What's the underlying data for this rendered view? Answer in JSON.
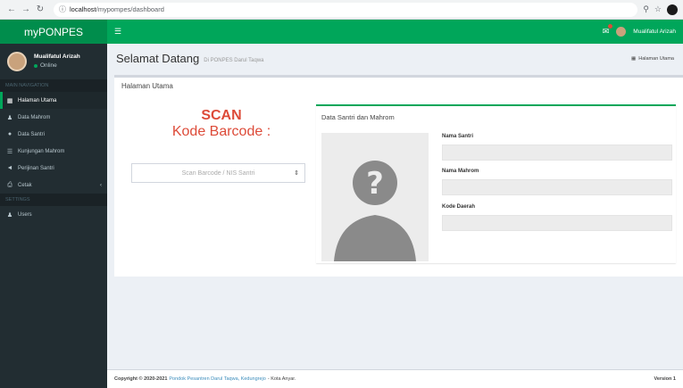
{
  "browser": {
    "url_host": "localhost",
    "url_path": "/mypompes/dashboard",
    "back_icon": "arrow-left-icon",
    "forward_icon": "arrow-right-icon",
    "reload_icon": "reload-icon",
    "info_icon": "info-icon"
  },
  "app": {
    "logo": "myPONPES",
    "colors": {
      "primary": "#00a65a",
      "logo_bg": "#008d4c",
      "sidebar": "#222d32",
      "accent": "#dd4b39"
    }
  },
  "sidebar": {
    "user_name": "Mualifatul Arizah",
    "user_status": "Online",
    "section_main": "MAIN NAVIGATION",
    "section_settings": "SETTINGS",
    "items": [
      {
        "label": "Halaman Utama",
        "icon": "dashboard-icon",
        "active": true
      },
      {
        "label": "Data Mahrom",
        "icon": "users-icon"
      },
      {
        "label": "Data Santri",
        "icon": "user-icon"
      },
      {
        "label": "Kunjungan Mahrom",
        "icon": "list-icon"
      },
      {
        "label": "Perijinan Santri",
        "icon": "megaphone-icon"
      },
      {
        "label": "Cetak",
        "icon": "print-icon",
        "has_submenu": true
      }
    ],
    "settings_items": [
      {
        "label": "Users",
        "icon": "user-icon"
      }
    ]
  },
  "topbar": {
    "user_name": "Mualifatul Arizah"
  },
  "header": {
    "title": "Selamat Datang",
    "subtitle": "Di PONPES Darul Taqwa",
    "breadcrumb": "Halaman Utama"
  },
  "main": {
    "box_title": "Halaman Utama",
    "scan_title": "SCAN",
    "scan_subtitle": "Kode Barcode :",
    "scan_placeholder": "Scan Barcode / NIS Santri",
    "detail_title": "Data Santri dan Mahrom",
    "fields": [
      {
        "label": "Nama Santri",
        "value": ""
      },
      {
        "label": "Nama Mahrom",
        "value": ""
      },
      {
        "label": "Kode Daerah",
        "value": ""
      }
    ]
  },
  "footer": {
    "copyright": "Copyright © 2020-2021",
    "org": "Pondok Pesantren Darul Taqwa, Kedungrejo",
    "credit": "- Kota Anyar.",
    "version": "Version 1"
  }
}
